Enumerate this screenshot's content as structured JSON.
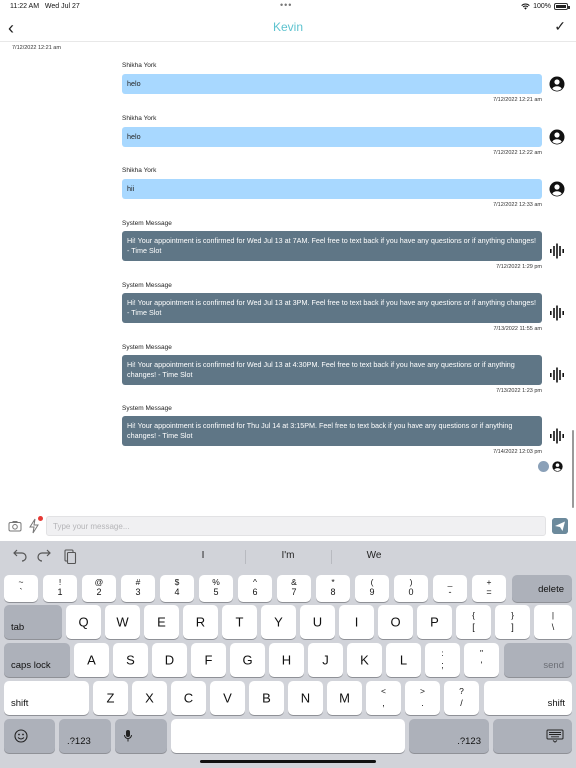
{
  "status": {
    "time": "11:22 AM",
    "date": "Wed Jul 27",
    "battery": "100%",
    "dots": "•••"
  },
  "nav": {
    "back": "‹",
    "title": "Kevin",
    "check": "✓"
  },
  "first_timestamp": "7/12/2022 12:21 am",
  "messages": [
    {
      "sender": "Shikha York",
      "text": "helo",
      "time": "7/12/2022 12:21 am",
      "kind": "user"
    },
    {
      "sender": "Shikha York",
      "text": "helo",
      "time": "7/12/2022 12:22 am",
      "kind": "user"
    },
    {
      "sender": "Shikha York",
      "text": "hii",
      "time": "7/12/2022 12:33 am",
      "kind": "user"
    },
    {
      "sender": "System Message",
      "text": "Hi! Your appointment is confirmed for Wed Jul 13 at 7AM. Feel free to text back if you have any questions or if anything changes! - Time Slot",
      "time": "7/12/2022 1:29 pm",
      "kind": "system"
    },
    {
      "sender": "System Message",
      "text": "Hi! Your appointment is confirmed for Wed Jul 13 at 3PM. Feel free to text back if you have any questions or if anything changes! - Time Slot",
      "time": "7/13/2022 11:55 am",
      "kind": "system"
    },
    {
      "sender": "System Message",
      "text": "Hi! Your appointment is confirmed for Wed Jul 13 at 4:30PM. Feel free to text back if you have any questions or if anything changes! - Time Slot",
      "time": "7/13/2022 1:23 pm",
      "kind": "system"
    },
    {
      "sender": "System Message",
      "text": "Hi! Your appointment is confirmed for Thu Jul 14 at 3:15PM. Feel free to text back if you have any questions or if anything changes! - Time Slot",
      "time": "7/14/2022 12:03 pm",
      "kind": "system"
    }
  ],
  "composer": {
    "placeholder": "Type your message..."
  },
  "keyboard": {
    "suggestions": [
      "I",
      "I'm",
      "We"
    ],
    "number_row": [
      {
        "top": "~",
        "bottom": "`"
      },
      {
        "top": "!",
        "bottom": "1"
      },
      {
        "top": "@",
        "bottom": "2"
      },
      {
        "top": "#",
        "bottom": "3"
      },
      {
        "top": "$",
        "bottom": "4"
      },
      {
        "top": "%",
        "bottom": "5"
      },
      {
        "top": "^",
        "bottom": "6"
      },
      {
        "top": "&",
        "bottom": "7"
      },
      {
        "top": "*",
        "bottom": "8"
      },
      {
        "top": "(",
        "bottom": "9"
      },
      {
        "top": ")",
        "bottom": "0"
      },
      {
        "top": "_",
        "bottom": "-"
      },
      {
        "top": "+",
        "bottom": "="
      }
    ],
    "delete": "delete",
    "tab": "tab",
    "row_q": [
      "Q",
      "W",
      "E",
      "R",
      "T",
      "Y",
      "U",
      "I",
      "O",
      "P"
    ],
    "row_q_extra": [
      {
        "top": "{",
        "bottom": "["
      },
      {
        "top": "}",
        "bottom": "]"
      },
      {
        "top": "|",
        "bottom": "\\"
      }
    ],
    "caps": "caps lock",
    "row_a": [
      "A",
      "S",
      "D",
      "F",
      "G",
      "H",
      "J",
      "K",
      "L"
    ],
    "row_a_extra": [
      {
        "top": ":",
        "bottom": ";"
      },
      {
        "top": "\"",
        "bottom": "'"
      }
    ],
    "send": "send",
    "shift": "shift",
    "row_z": [
      "Z",
      "X",
      "C",
      "V",
      "B",
      "N",
      "M"
    ],
    "row_z_extra": [
      {
        "top": "<",
        "bottom": ","
      },
      {
        "top": ">",
        "bottom": "."
      },
      {
        "top": "?",
        "bottom": "/"
      }
    ],
    "numbers": ".?123"
  }
}
